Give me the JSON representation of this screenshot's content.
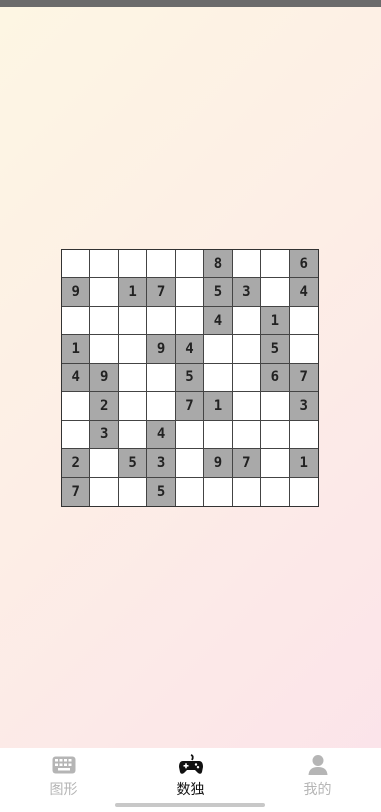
{
  "sudoku": {
    "rows": [
      [
        "",
        "",
        "",
        "",
        "",
        "8",
        "",
        "",
        "6"
      ],
      [
        "9",
        "",
        "1",
        "7",
        "",
        "5",
        "3",
        "",
        "4"
      ],
      [
        "",
        "",
        "",
        "",
        "",
        "4",
        "",
        "1",
        ""
      ],
      [
        "1",
        "",
        "",
        "9",
        "4",
        "",
        "",
        "5",
        ""
      ],
      [
        "4",
        "9",
        "",
        "",
        "5",
        "",
        "",
        "6",
        "7"
      ],
      [
        "",
        "2",
        "",
        "",
        "7",
        "1",
        "",
        "",
        "3"
      ],
      [
        "",
        "3",
        "",
        "4",
        "",
        "",
        "",
        "",
        ""
      ],
      [
        "2",
        "",
        "5",
        "3",
        "",
        "9",
        "7",
        "",
        "1"
      ],
      [
        "7",
        "",
        "",
        "5",
        "",
        "",
        "",
        "",
        ""
      ]
    ]
  },
  "tab_bar": {
    "tabs": [
      {
        "label": "图形",
        "icon": "keyboard-icon",
        "active": false
      },
      {
        "label": "数独",
        "icon": "gamepad-icon",
        "active": true
      },
      {
        "label": "我的",
        "icon": "person-icon",
        "active": false
      }
    ]
  },
  "colors": {
    "given_cell": "#a9a9a9",
    "empty_cell": "#ffffff",
    "active_tab": "#111111",
    "inactive_tab": "#b5b5b5"
  }
}
